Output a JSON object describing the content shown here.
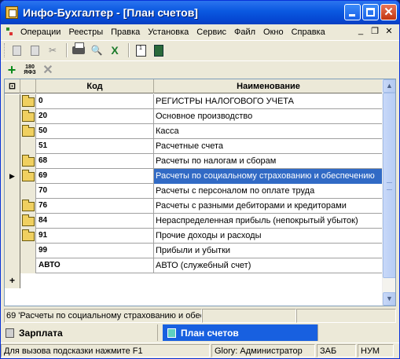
{
  "window": {
    "title": "Инфо-Бухгалтер - [План счетов]"
  },
  "menu": [
    "Операции",
    "Реестры",
    "Правка",
    "Установка",
    "Сервис",
    "Файл",
    "Окно",
    "Справка"
  ],
  "toolbar_icons": [
    "copy-icon",
    "paste-icon",
    "cut-icon",
    "print-icon",
    "preview-icon",
    "excel-icon",
    "calendar-icon",
    "calculator-icon"
  ],
  "toolbar2": {
    "add_icon": "plus-icon",
    "sort_label": "180\nЯФЗ",
    "delete_icon": "x-icon"
  },
  "grid": {
    "headers": {
      "code": "Код",
      "name": "Наименование"
    },
    "rows": [
      {
        "code": "0",
        "name": "РЕГИСТРЫ НАЛОГОВОГО УЧЕТА",
        "folder": true
      },
      {
        "code": "20",
        "name": "Основное производство",
        "folder": true
      },
      {
        "code": "50",
        "name": "Касса",
        "folder": true
      },
      {
        "code": "51",
        "name": "Расчетные счета",
        "folder": false
      },
      {
        "code": "68",
        "name": "Расчеты по налогам и сборам",
        "folder": true
      },
      {
        "code": "69",
        "name": "Расчеты по социальному страхованию и обеспечению",
        "folder": true,
        "selected": true
      },
      {
        "code": "70",
        "name": "Расчеты с персоналом по оплате труда",
        "folder": false
      },
      {
        "code": "76",
        "name": "Расчеты с разными дебиторами и кредиторами",
        "folder": true
      },
      {
        "code": "84",
        "name": "Нераспределенная прибыль (непокрытый убыток)",
        "folder": true
      },
      {
        "code": "91",
        "name": "Прочие доходы и расходы",
        "folder": true
      },
      {
        "code": "99",
        "name": "Прибыли и убытки",
        "folder": false
      },
      {
        "code": "АВТО",
        "name": "АВТО (служебный счет)",
        "folder": false
      }
    ],
    "new_row_marker": "+"
  },
  "info": {
    "current": "69 'Расчеты по социальному страхованию и обес"
  },
  "tasks": [
    {
      "label": "Зарплата",
      "active": false
    },
    {
      "label": "План счетов",
      "active": true
    }
  ],
  "status": {
    "hint": "Для вызова подсказки нажмите F1",
    "user": "Glory: Администратор",
    "caps": "ЗАБ",
    "num": "НУМ"
  }
}
